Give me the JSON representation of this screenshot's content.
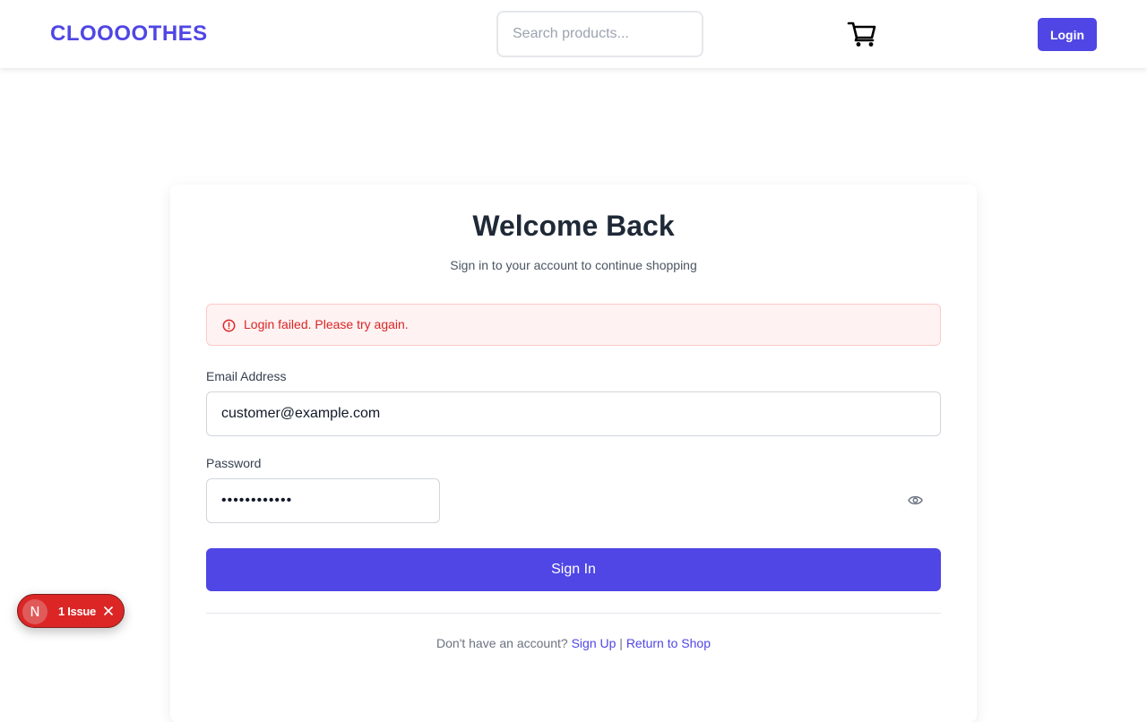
{
  "header": {
    "brand": "CLOOOOTHES",
    "search_placeholder": "Search products...",
    "login_label": "Login"
  },
  "login_form": {
    "title": "Welcome Back",
    "subtitle": "Sign in to your account to continue shopping",
    "error_message": "Login failed. Please try again.",
    "email_label": "Email Address",
    "email_value": "customer@example.com",
    "password_label": "Password",
    "password_value": "••••••••••••",
    "submit_label": "Sign In",
    "footer_prefix": "Don't have an account?",
    "signup_link": "Sign Up",
    "separator": "|",
    "return_link": "Return to Shop"
  },
  "dev_overlay": {
    "badge_letter": "N",
    "issues_label": "1 Issue"
  },
  "icons": {
    "cart": "cart-icon",
    "alert": "alert-circle-icon",
    "eye": "eye-icon",
    "close": "close-icon"
  },
  "colors": {
    "brand": "#4f46e5",
    "error": "#dc2626",
    "error_bg": "#fef2f2"
  }
}
